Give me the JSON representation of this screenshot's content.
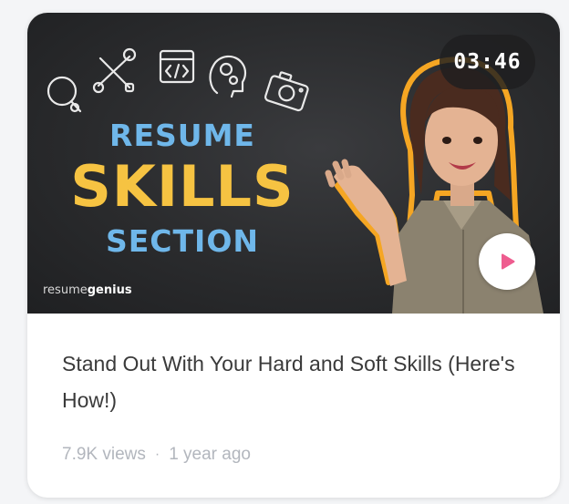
{
  "video": {
    "duration": "03:46",
    "headline": {
      "line1": "RESUME",
      "line2": "SKILLS",
      "line3": "SECTION"
    },
    "brand": {
      "part1": "resume",
      "part2": "genius"
    },
    "title": "Stand Out With Your Hard and Soft Skills (Here's How!)",
    "views": "7.9K views",
    "separator": "·",
    "age": "1 year ago"
  },
  "icons": {
    "play": "play-icon",
    "doodles": [
      "magnifier-icon",
      "tools-icon",
      "code-window-icon",
      "head-gears-icon",
      "camera-icon"
    ]
  },
  "colors": {
    "accent_blue": "#6fb7ea",
    "accent_yellow": "#f6c342",
    "play_pink": "#ee5c8f",
    "outline_orange": "#f5a623"
  }
}
